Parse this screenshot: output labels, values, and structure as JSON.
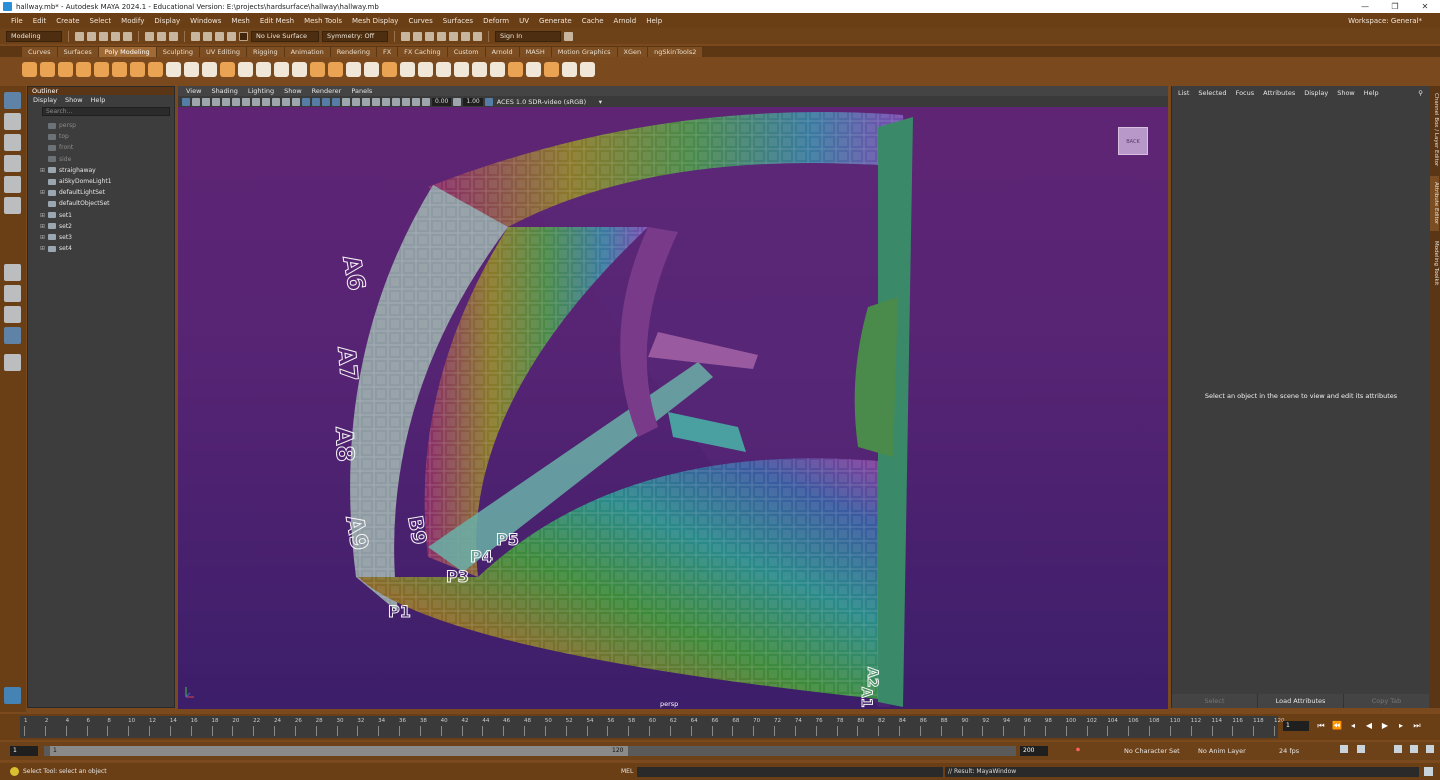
{
  "window": {
    "title": "hallway.mb* - Autodesk MAYA 2024.1 - Educational Version: E:\\projects\\hardsurface\\hallway\\hallway.mb",
    "controls": [
      "—",
      "❐",
      "✕"
    ]
  },
  "menubar": {
    "items": [
      "File",
      "Edit",
      "Create",
      "Select",
      "Modify",
      "Display",
      "Windows",
      "Mesh",
      "Edit Mesh",
      "Mesh Tools",
      "Mesh Display",
      "Curves",
      "Surfaces",
      "Deform",
      "UV",
      "Generate",
      "Cache",
      "Arnold",
      "Help"
    ],
    "workspace_label": "Workspace: General*"
  },
  "statusline": {
    "mode": "Modeling",
    "live_surface": "No Live Surface",
    "symmetry": "Symmetry: Off",
    "sign_in": "Sign In"
  },
  "shelf": {
    "tabs": [
      "Curves",
      "Surfaces",
      "Poly Modeling",
      "Sculpting",
      "UV Editing",
      "Rigging",
      "Animation",
      "Rendering",
      "FX",
      "FX Caching",
      "Custom",
      "Arnold",
      "MASH",
      "Motion Graphics",
      "XGen",
      "ngSkinTools2"
    ],
    "active_tab": "Poly Modeling"
  },
  "outliner": {
    "title": "Outliner",
    "menus": [
      "Display",
      "Show",
      "Help"
    ],
    "search_placeholder": "Search...",
    "items": [
      {
        "label": "persp",
        "dim": true,
        "expandable": false
      },
      {
        "label": "top",
        "dim": true,
        "expandable": false
      },
      {
        "label": "front",
        "dim": true,
        "expandable": false
      },
      {
        "label": "side",
        "dim": true,
        "expandable": false
      },
      {
        "label": "straighaway",
        "dim": false,
        "expandable": true
      },
      {
        "label": "aiSkyDomeLight1",
        "dim": false,
        "expandable": false
      },
      {
        "label": "defaultLightSet",
        "dim": false,
        "expandable": true
      },
      {
        "label": "defaultObjectSet",
        "dim": false,
        "expandable": false
      },
      {
        "label": "set1",
        "dim": false,
        "expandable": true
      },
      {
        "label": "set2",
        "dim": false,
        "expandable": true
      },
      {
        "label": "set3",
        "dim": false,
        "expandable": true
      },
      {
        "label": "set4",
        "dim": false,
        "expandable": true
      }
    ]
  },
  "viewport": {
    "menus": [
      "View",
      "Shading",
      "Lighting",
      "Show",
      "Renderer",
      "Panels"
    ],
    "exposure": "0.00",
    "gamma": "1.00",
    "color_space": "ACES 1.0 SDR-video (sRGB)",
    "camera": "persp",
    "viewcube_label": "BACK",
    "background_colors": [
      "#5f2574",
      "#3c1e6a"
    ]
  },
  "attribute_editor": {
    "menus": [
      "List",
      "Selected",
      "Focus",
      "Attributes",
      "Display",
      "Show",
      "Help"
    ],
    "message": "Select an object in the scene to view and edit its attributes",
    "buttons": [
      "Select",
      "Load Attributes",
      "Copy Tab"
    ]
  },
  "right_tabs": [
    "Channel Box / Layer Editor",
    "Attribute Editor",
    "Modeling Toolkit"
  ],
  "timeline": {
    "ticks": [
      "1",
      "2",
      "4",
      "6",
      "8",
      "10",
      "12",
      "14",
      "16",
      "18",
      "20",
      "22",
      "24",
      "26",
      "28",
      "30",
      "32",
      "34",
      "36",
      "38",
      "40",
      "42",
      "44",
      "46",
      "48",
      "50",
      "52",
      "54",
      "56",
      "58",
      "60",
      "62",
      "64",
      "66",
      "68",
      "70",
      "72",
      "74",
      "76",
      "78",
      "80",
      "82",
      "84",
      "86",
      "88",
      "90",
      "92",
      "94",
      "96",
      "98",
      "100",
      "102",
      "104",
      "106",
      "108",
      "110",
      "112",
      "114",
      "116",
      "118",
      "120"
    ],
    "current_frame": "1"
  },
  "range": {
    "start": "1",
    "inner_start": "1",
    "inner_end": "120",
    "end": "200",
    "character_set": "No Character Set",
    "anim_layer": "No Anim Layer",
    "fps": "24 fps"
  },
  "commandline": {
    "help": "Select Tool: select an object",
    "lang": "MEL",
    "result": "// Result: MayaWindow"
  }
}
